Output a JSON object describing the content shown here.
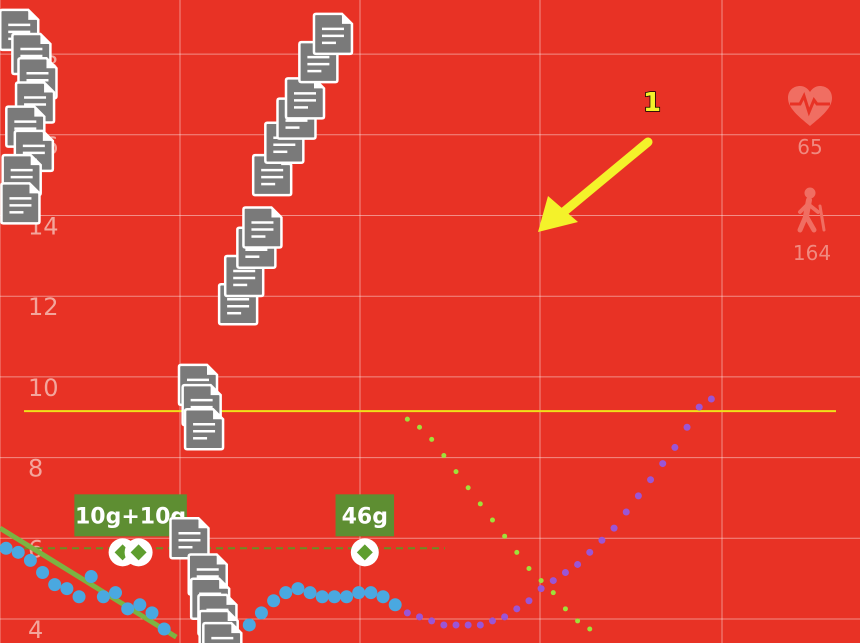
{
  "chart_data": {
    "type": "scatter",
    "background_color": "#e83225",
    "grid": true,
    "y_axis": {
      "ticks": [
        4,
        6,
        8,
        10,
        12,
        14,
        16,
        18
      ]
    },
    "target_line": {
      "value": 9.4,
      "color": "#f0e01a"
    },
    "low_line": {
      "value": 6.0,
      "color": "#6b8e23"
    },
    "bg_readings": {
      "color": "#4aa8e0",
      "points": [
        [
          0.5,
          6.0
        ],
        [
          1.5,
          5.9
        ],
        [
          2.5,
          5.7
        ],
        [
          3.5,
          5.4
        ],
        [
          4.5,
          5.1
        ],
        [
          5.5,
          5.0
        ],
        [
          6.5,
          4.8
        ],
        [
          7.5,
          5.3
        ],
        [
          8.5,
          4.8
        ],
        [
          9.5,
          4.9
        ],
        [
          10.5,
          4.5
        ],
        [
          11.5,
          4.6
        ],
        [
          12.5,
          4.4
        ],
        [
          13.5,
          4.0
        ],
        [
          20.5,
          4.1
        ],
        [
          21.5,
          4.4
        ],
        [
          22.5,
          4.7
        ],
        [
          23.5,
          4.9
        ],
        [
          24.5,
          5.0
        ],
        [
          25.5,
          4.9
        ],
        [
          26.5,
          4.8
        ],
        [
          27.5,
          4.8
        ],
        [
          28.5,
          4.8
        ],
        [
          29.5,
          4.9
        ],
        [
          30.5,
          4.9
        ],
        [
          31.5,
          4.8
        ],
        [
          32.5,
          4.6
        ]
      ]
    },
    "prediction_dots": {
      "color": "#9a55d6",
      "points": [
        [
          33.5,
          4.4
        ],
        [
          34.5,
          4.3
        ],
        [
          35.5,
          4.2
        ],
        [
          36.5,
          4.1
        ],
        [
          37.5,
          4.1
        ],
        [
          38.5,
          4.1
        ],
        [
          39.5,
          4.1
        ],
        [
          40.5,
          4.2
        ],
        [
          41.5,
          4.3
        ],
        [
          42.5,
          4.5
        ],
        [
          43.5,
          4.7
        ],
        [
          44.5,
          5.0
        ],
        [
          45.5,
          5.2
        ],
        [
          46.5,
          5.4
        ],
        [
          47.5,
          5.6
        ],
        [
          48.5,
          5.9
        ],
        [
          49.5,
          6.2
        ],
        [
          50.5,
          6.5
        ],
        [
          51.5,
          6.9
        ],
        [
          52.5,
          7.3
        ],
        [
          53.5,
          7.7
        ],
        [
          54.5,
          8.1
        ],
        [
          55.5,
          8.5
        ],
        [
          56.5,
          9.0
        ],
        [
          57.5,
          9.5
        ],
        [
          58.5,
          9.7
        ]
      ]
    },
    "cob_prediction_dots": {
      "color": "#9fe03a",
      "points": [
        [
          33.5,
          9.2
        ],
        [
          34.5,
          9.0
        ],
        [
          35.5,
          8.7
        ],
        [
          36.5,
          8.3
        ],
        [
          37.5,
          7.9
        ],
        [
          38.5,
          7.5
        ],
        [
          39.5,
          7.1
        ],
        [
          40.5,
          6.7
        ],
        [
          41.5,
          6.3
        ],
        [
          42.5,
          5.9
        ],
        [
          43.5,
          5.5
        ],
        [
          44.5,
          5.2
        ],
        [
          45.5,
          4.9
        ],
        [
          46.5,
          4.5
        ],
        [
          47.5,
          4.2
        ],
        [
          48.5,
          4.0
        ]
      ]
    },
    "treatments": [
      {
        "label": "10g+10g",
        "x": 10.0,
        "y": 5.9,
        "double": true
      },
      {
        "label": "46g",
        "x": 30.0,
        "y": 5.9,
        "double": false
      }
    ],
    "notes": [
      [
        1.5,
        18.8
      ],
      [
        2.5,
        18.2
      ],
      [
        3.0,
        17.6
      ],
      [
        2.8,
        17.0
      ],
      [
        2.0,
        16.4
      ],
      [
        2.7,
        15.8
      ],
      [
        1.7,
        15.2
      ],
      [
        1.6,
        14.5
      ],
      [
        16.2,
        10.0
      ],
      [
        16.5,
        9.5
      ],
      [
        16.7,
        8.9
      ],
      [
        15.5,
        6.2
      ],
      [
        17.0,
        5.3
      ],
      [
        17.2,
        4.7
      ],
      [
        17.8,
        4.3
      ],
      [
        17.9,
        3.9
      ],
      [
        18.2,
        3.6
      ],
      [
        19.5,
        12.0
      ],
      [
        20.0,
        12.7
      ],
      [
        21.0,
        13.4
      ],
      [
        21.5,
        13.9
      ],
      [
        22.3,
        15.2
      ],
      [
        23.3,
        16.0
      ],
      [
        24.3,
        16.6
      ],
      [
        25.0,
        17.1
      ],
      [
        26.1,
        18.0
      ],
      [
        27.3,
        18.7
      ]
    ],
    "iob_line": {
      "color": "#7cb342",
      "points": [
        [
          0.0,
          6.5
        ],
        [
          14.5,
          3.8
        ]
      ]
    },
    "side_stats": [
      {
        "icon": "heart-rate-icon",
        "value": "65"
      },
      {
        "icon": "walking-icon",
        "value": "164"
      }
    ],
    "callout": {
      "label": "1",
      "color": "#f4f22a"
    }
  }
}
